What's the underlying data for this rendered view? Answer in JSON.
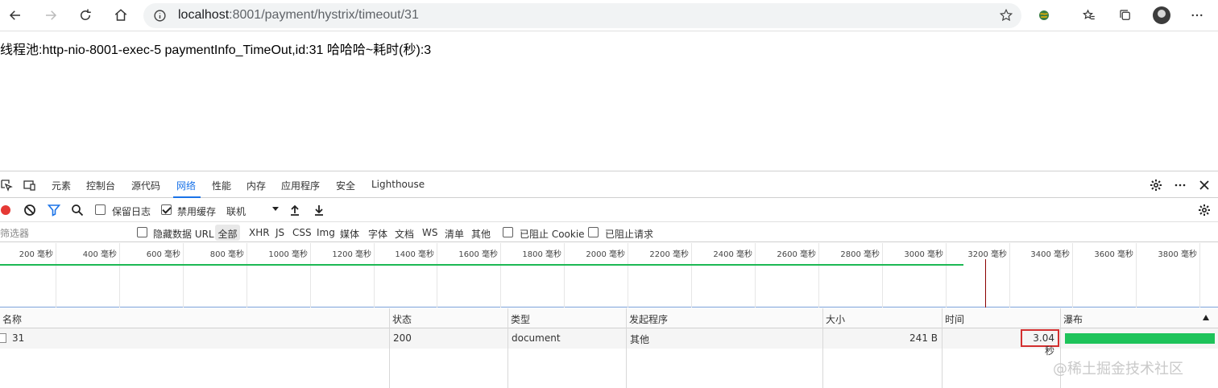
{
  "browser": {
    "url_host": "localhost",
    "url_path": ":8001/payment/hystrix/timeout/31"
  },
  "page": {
    "text": "线程池:http-nio-8001-exec-5 paymentInfo_TimeOut,id:31 哈哈哈~耗时(秒):3"
  },
  "devtools": {
    "tabs": [
      "元素",
      "控制台",
      "源代码",
      "网络",
      "性能",
      "内存",
      "应用程序",
      "安全",
      "Lighthouse"
    ],
    "active_tab": "网络",
    "toolbar": {
      "preserve_log": "保留日志",
      "preserve_log_checked": false,
      "disable_cache": "禁用缓存",
      "disable_cache_checked": true,
      "throttle": "联机"
    },
    "filter": {
      "placeholder": "筛选器",
      "hide_data_urls": "隐藏数据 URL",
      "types": [
        "全部",
        "XHR",
        "JS",
        "CSS",
        "Img",
        "媒体",
        "字体",
        "文档",
        "WS",
        "清单",
        "其他"
      ],
      "blocked_cookies": "已阻止 Cookie",
      "blocked_requests": "已阻止请求"
    },
    "overview_ticks": [
      "200 毫秒",
      "400 毫秒",
      "600 毫秒",
      "800 毫秒",
      "1000 毫秒",
      "1200 毫秒",
      "1400 毫秒",
      "1600 毫秒",
      "1800 毫秒",
      "2000 毫秒",
      "2200 毫秒",
      "2400 毫秒",
      "2600 毫秒",
      "2800 毫秒",
      "3000 毫秒",
      "3200 毫秒",
      "3400 毫秒",
      "3600 毫秒",
      "3800 毫秒"
    ],
    "columns": {
      "name": "名称",
      "status": "状态",
      "type": "类型",
      "initiator": "发起程序",
      "size": "大小",
      "time": "时间",
      "waterfall": "瀑布"
    },
    "rows": [
      {
        "name": "31",
        "status": "200",
        "type": "document",
        "initiator": "其他",
        "size": "241 B",
        "time": "3.04 秒"
      }
    ]
  },
  "watermark": "@稀土掘金技术社区",
  "colors": {
    "accent": "#1a73e8",
    "record": "#e53935",
    "waterfall": "#1ec35a",
    "highlight_box": "#d32f2f"
  }
}
